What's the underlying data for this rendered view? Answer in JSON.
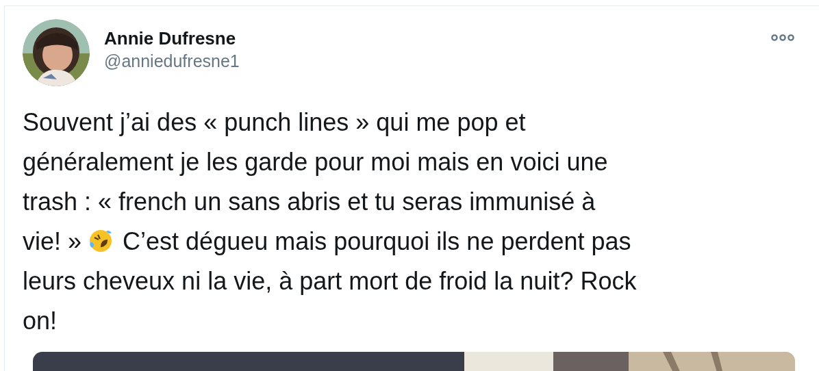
{
  "tweet": {
    "author": {
      "name": "Annie Dufresne",
      "handle": "@anniedufresne1"
    },
    "lines": [
      [
        {
          "kind": "text",
          "text": "Souvent j’ai des « punch lines » qui me pop et"
        }
      ],
      [
        {
          "kind": "text",
          "text": "généralement je les garde pour moi mais en voici une"
        }
      ],
      [
        {
          "kind": "text",
          "text": "trash : « french un sans abris et tu seras immunisé à"
        }
      ],
      [
        {
          "kind": "text",
          "text": "vie! »"
        },
        {
          "kind": "emoji"
        },
        {
          "kind": "text",
          "text": "C’est dégueu mais pourquoi ils ne perdent pas"
        }
      ],
      [
        {
          "kind": "text",
          "text": "leurs cheveux ni la vie, à part mort de froid la nuit? Rock"
        }
      ],
      [
        {
          "kind": "text",
          "text": "on!"
        }
      ]
    ]
  }
}
